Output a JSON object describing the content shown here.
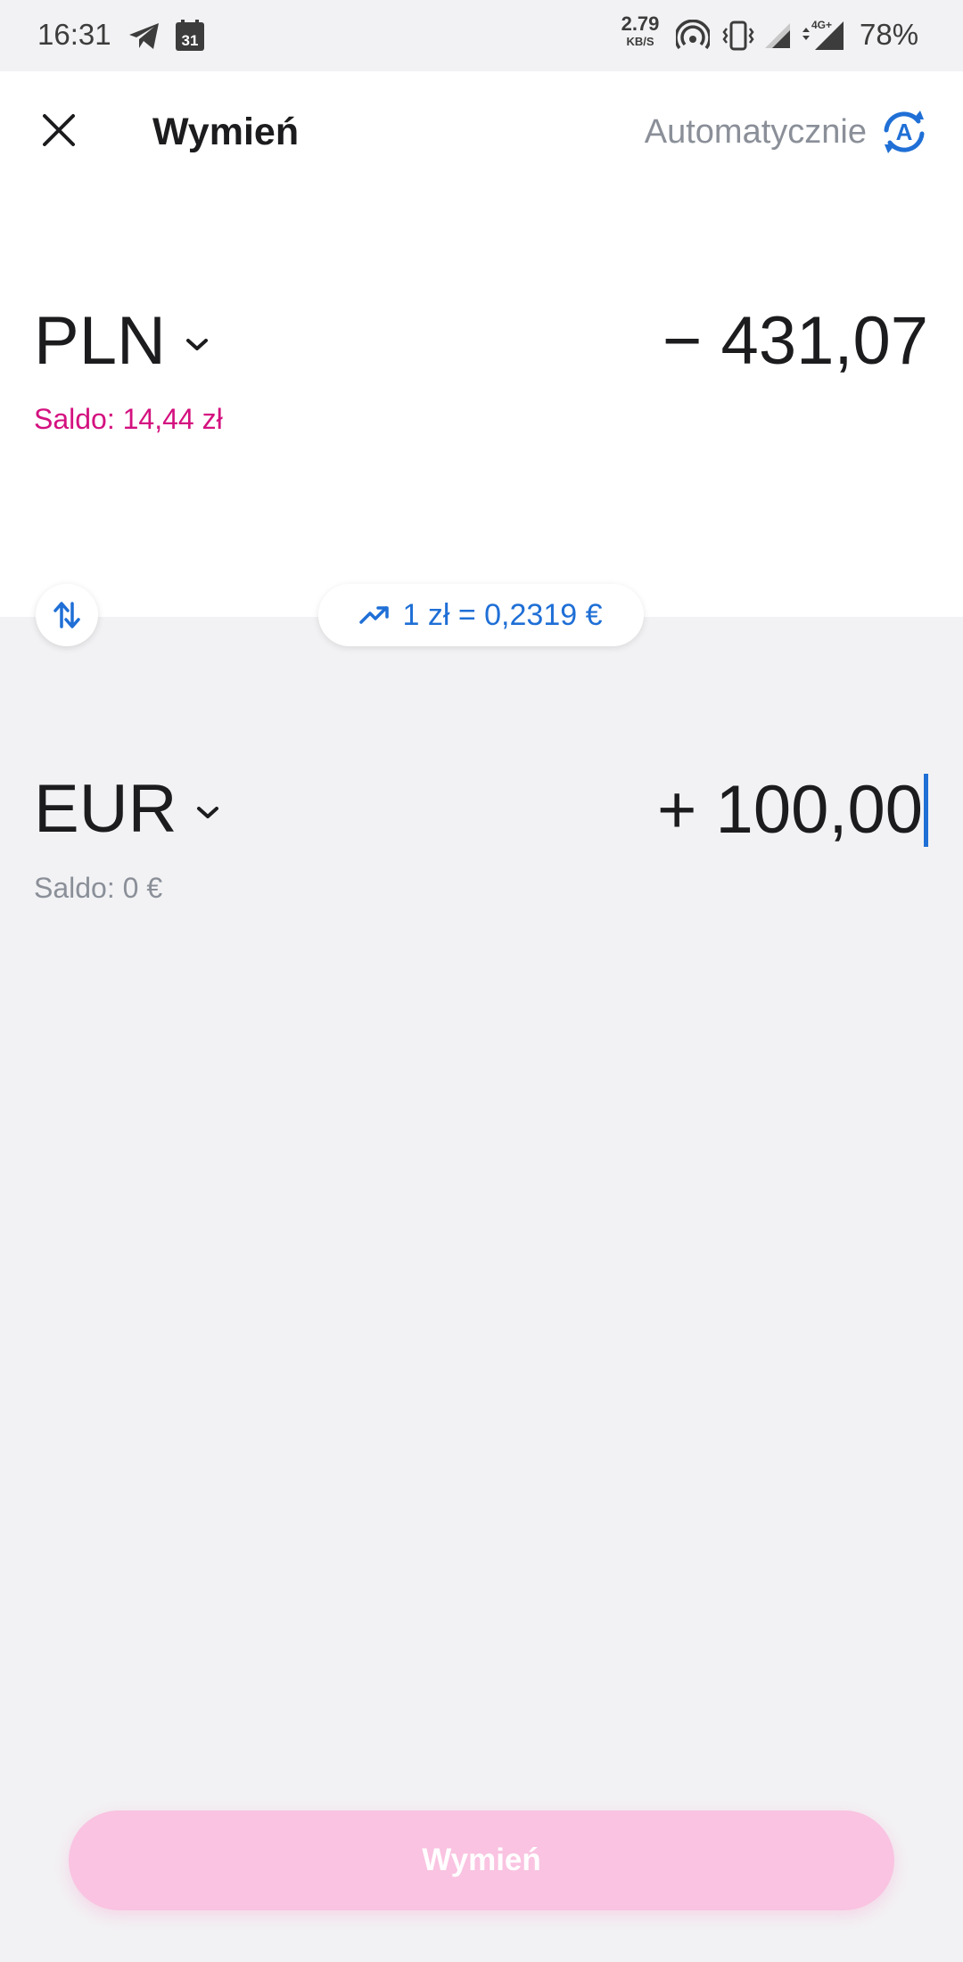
{
  "status_bar": {
    "time": "16:31",
    "calendar_day": "31",
    "net_speed_value": "2.79",
    "net_speed_unit": "KB/S",
    "network_type": "4G+",
    "battery": "78%"
  },
  "header": {
    "title": "Wymień",
    "auto_label": "Automatycznie",
    "auto_icon_letter": "A"
  },
  "from": {
    "currency": "PLN",
    "amount": "− 431,07",
    "balance": "Saldo: 14,44 zł"
  },
  "rate": {
    "text": "1 zł = 0,2319 €"
  },
  "to": {
    "currency": "EUR",
    "amount": "+ 100,00",
    "balance": "Saldo: 0 €"
  },
  "cta": {
    "label": "Wymień"
  },
  "colors": {
    "accent_blue": "#1f6fd6",
    "negative_pink": "#d4117f",
    "cta_disabled": "#f9c3e1",
    "muted": "#8a8f98"
  },
  "icons": [
    "telegram-icon",
    "calendar-icon",
    "hotspot-icon",
    "vibrate-icon",
    "signal-icon",
    "close-icon",
    "auto-exchange-icon",
    "chevron-down-icon",
    "swap-icon",
    "trend-up-icon"
  ]
}
